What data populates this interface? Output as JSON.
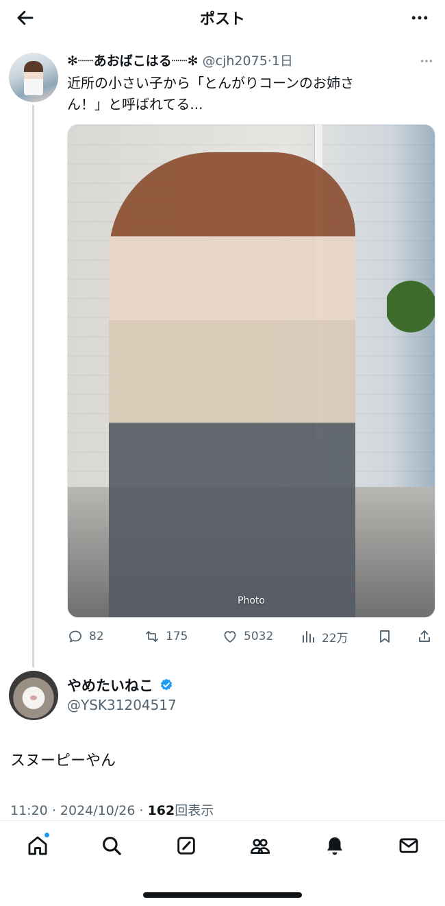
{
  "header": {
    "title": "ポスト",
    "back_icon": "arrow-left-icon",
    "more_icon": "more-horizontal-icon"
  },
  "tweet": {
    "display_name": "✻┈┈あおばこはる┈┈✻",
    "handle": "@cjh2075",
    "separator": "·",
    "age": "1日",
    "text_line1": "近所の小さい子から「とんがりコーンのお姉さ",
    "text_line2": "ん！」と呼ばれてる...",
    "media_alt": "Photo",
    "stats": {
      "replies": "82",
      "retweets": "175",
      "likes": "5032",
      "views": "22万"
    }
  },
  "reply": {
    "display_name": "やめたいねこ",
    "handle": "@YSK31204517",
    "verified": true,
    "text": "スヌーピーやん",
    "time": "11:20",
    "date": "2024/10/26",
    "dot": "·",
    "view_count": "162",
    "view_label": "回表示"
  },
  "nav": {
    "items": [
      "home-icon",
      "search-icon",
      "compose-icon",
      "communities-icon",
      "notifications-icon",
      "messages-icon"
    ],
    "home_has_badge": true
  },
  "colors": {
    "text_primary": "#0f1419",
    "text_secondary": "#536471",
    "accent": "#1d9bf0",
    "thread_line": "#cfd9de"
  }
}
